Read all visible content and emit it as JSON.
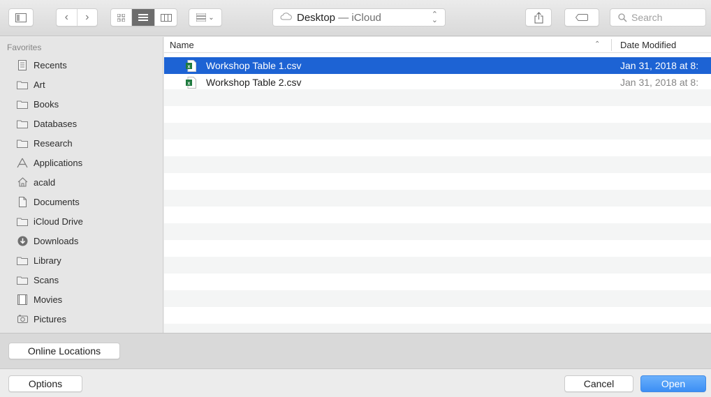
{
  "toolbar": {
    "location": "Desktop",
    "location_sub": "iCloud",
    "separator": " — ",
    "search_placeholder": "Search"
  },
  "sidebar": {
    "heading": "Favorites",
    "items": [
      {
        "label": "Recents",
        "icon": "recents-icon"
      },
      {
        "label": "Art",
        "icon": "folder-icon"
      },
      {
        "label": "Books",
        "icon": "folder-icon"
      },
      {
        "label": "Databases",
        "icon": "folder-icon"
      },
      {
        "label": "Research",
        "icon": "folder-icon"
      },
      {
        "label": "Applications",
        "icon": "applications-icon"
      },
      {
        "label": "acald",
        "icon": "home-icon"
      },
      {
        "label": "Documents",
        "icon": "documents-icon"
      },
      {
        "label": "iCloud Drive",
        "icon": "folder-icon"
      },
      {
        "label": "Downloads",
        "icon": "downloads-icon"
      },
      {
        "label": "Library",
        "icon": "folder-icon"
      },
      {
        "label": "Scans",
        "icon": "folder-icon"
      },
      {
        "label": "Movies",
        "icon": "movies-icon"
      },
      {
        "label": "Pictures",
        "icon": "pictures-icon"
      }
    ]
  },
  "file_list": {
    "columns": {
      "name": "Name",
      "date": "Date Modified"
    },
    "files": [
      {
        "name": "Workshop Table 1.csv",
        "date": "Jan 31, 2018 at 8:",
        "selected": true
      },
      {
        "name": "Workshop Table 2.csv",
        "date": "Jan 31, 2018 at 8:",
        "selected": false
      }
    ]
  },
  "locations": {
    "online_label": "Online Locations"
  },
  "footer": {
    "options_label": "Options",
    "cancel_label": "Cancel",
    "open_label": "Open"
  },
  "colors": {
    "selection": "#1d63d4",
    "primary_button": "#3c8ff5"
  }
}
